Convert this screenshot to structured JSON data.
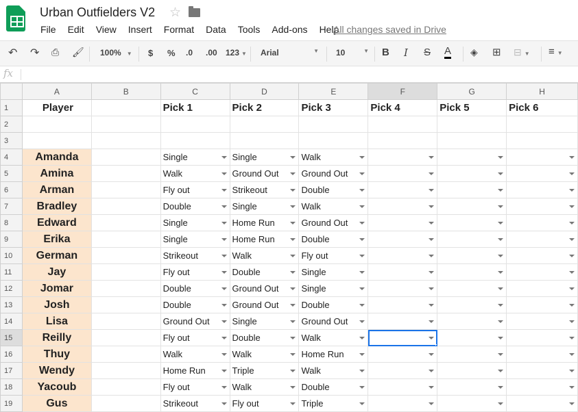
{
  "app": {
    "doc_title": "Urban Outfielders V2",
    "saved_status": "All changes saved in Drive",
    "menu": [
      "File",
      "Edit",
      "View",
      "Insert",
      "Format",
      "Data",
      "Tools",
      "Add-ons",
      "Help"
    ]
  },
  "toolbar": {
    "zoom": "100%",
    "currency": "$",
    "percent": "%",
    "dec_decrease": ".0",
    "dec_increase": ".00",
    "more_formats": "123",
    "font": "Arial",
    "font_size": "10",
    "bold": "B",
    "italic": "I",
    "strike": "S",
    "text_color": "A"
  },
  "formula_bar": {
    "fx": "fx",
    "value": ""
  },
  "columns": [
    "A",
    "B",
    "C",
    "D",
    "E",
    "F",
    "G",
    "H"
  ],
  "selected_column": "F",
  "selected_row": "15",
  "header_row": {
    "row": "1",
    "player": "Player",
    "picks": [
      "Pick 1",
      "Pick 2",
      "Pick 3",
      "Pick 4",
      "Pick 5",
      "Pick 6"
    ]
  },
  "empty_rows": [
    "2",
    "3"
  ],
  "rows": [
    {
      "row": "4",
      "player": "Amanda",
      "picks": [
        "Single",
        "Single",
        "Walk",
        "",
        "",
        ""
      ]
    },
    {
      "row": "5",
      "player": "Amina",
      "picks": [
        "Walk",
        "Ground Out",
        "Ground Out",
        "",
        "",
        ""
      ]
    },
    {
      "row": "6",
      "player": "Arman",
      "picks": [
        "Fly out",
        "Strikeout",
        "Double",
        "",
        "",
        ""
      ]
    },
    {
      "row": "7",
      "player": "Bradley",
      "picks": [
        "Double",
        "Single",
        "Walk",
        "",
        "",
        ""
      ]
    },
    {
      "row": "8",
      "player": "Edward",
      "picks": [
        "Single",
        "Home Run",
        "Ground Out",
        "",
        "",
        ""
      ]
    },
    {
      "row": "9",
      "player": "Erika",
      "picks": [
        "Single",
        "Home Run",
        "Double",
        "",
        "",
        ""
      ]
    },
    {
      "row": "10",
      "player": "German",
      "picks": [
        "Strikeout",
        "Walk",
        "Fly out",
        "",
        "",
        ""
      ]
    },
    {
      "row": "11",
      "player": "Jay",
      "picks": [
        "Fly out",
        "Double",
        "Single",
        "",
        "",
        ""
      ]
    },
    {
      "row": "12",
      "player": "Jomar",
      "picks": [
        "Double",
        "Ground Out",
        "Single",
        "",
        "",
        ""
      ]
    },
    {
      "row": "13",
      "player": "Josh",
      "picks": [
        "Double",
        "Ground Out",
        "Double",
        "",
        "",
        ""
      ]
    },
    {
      "row": "14",
      "player": "Lisa",
      "picks": [
        "Ground Out",
        "Single",
        "Ground Out",
        "",
        "",
        ""
      ]
    },
    {
      "row": "15",
      "player": "Reilly",
      "picks": [
        "Fly out",
        "Double",
        "Walk",
        "",
        "",
        ""
      ]
    },
    {
      "row": "16",
      "player": "Thuy",
      "picks": [
        "Walk",
        "Walk",
        "Home Run",
        "",
        "",
        ""
      ]
    },
    {
      "row": "17",
      "player": "Wendy",
      "picks": [
        "Home Run",
        "Triple",
        "Walk",
        "",
        "",
        ""
      ]
    },
    {
      "row": "18",
      "player": "Yacoub",
      "picks": [
        "Fly out",
        "Walk",
        "Double",
        "",
        "",
        ""
      ]
    },
    {
      "row": "19",
      "player": "Gus",
      "picks": [
        "Strikeout",
        "Fly out",
        "Triple",
        "",
        "",
        ""
      ]
    }
  ],
  "colors": {
    "player_fill": "#fce5cd",
    "selection": "#1a73e8",
    "logo": "#0f9d58"
  }
}
